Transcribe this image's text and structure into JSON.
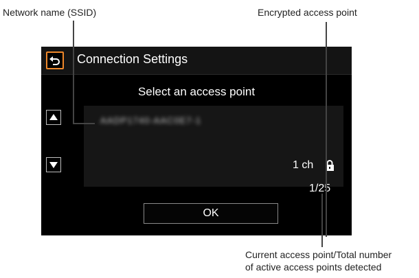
{
  "callouts": {
    "ssid": "Network name (SSID)",
    "encrypted": "Encrypted access point",
    "count_line1": "Current access point/Total number",
    "count_line2": "of active access points detected"
  },
  "screen": {
    "title": "Connection Settings",
    "subtitle": "Select an access point",
    "ssid_blurred": "AADP1740-AAC0E7-1",
    "channel": "1 ch",
    "counter": "1/25",
    "ok_label": "OK"
  },
  "icons": {
    "back": "back-arrow-icon",
    "up": "up-triangle-icon",
    "down": "down-triangle-icon",
    "lock": "lock-icon"
  },
  "colors": {
    "accent": "#f0882a",
    "screen_bg": "#000000",
    "panel_bg": "#161616"
  }
}
